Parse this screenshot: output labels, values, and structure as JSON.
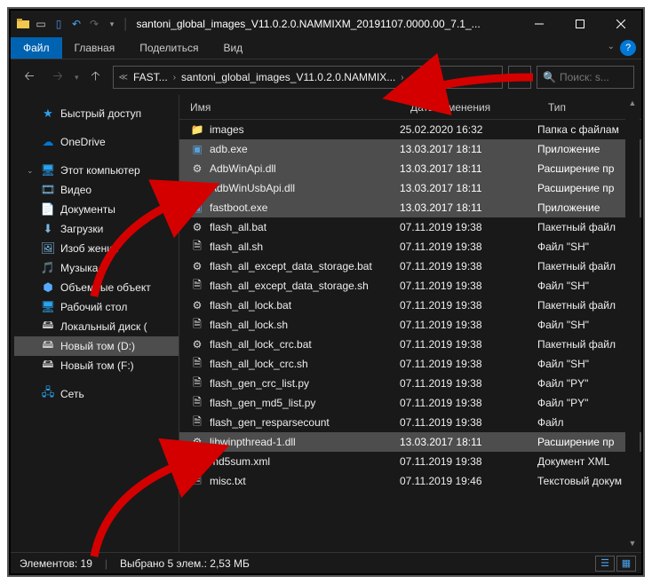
{
  "window": {
    "title": "santoni_global_images_V11.0.2.0.NAMMIXM_20191107.0000.00_7.1_..."
  },
  "ribbon": {
    "file": "Файл",
    "home": "Главная",
    "share": "Поделиться",
    "view": "Вид"
  },
  "address": {
    "crumb1": "FAST...",
    "crumb2": "santoni_global_images_V11.0.2.0.NAMMIX...",
    "search_placeholder": "Поиск: s..."
  },
  "nav": {
    "quick": "Быстрый доступ",
    "onedrive": "OneDrive",
    "pc": "Этот компьютер",
    "video": "Видео",
    "docs": "Документы",
    "downloads": "Загрузки",
    "images": "Изоб        жения",
    "music": "Музыка",
    "objects3d": "Объемные объект",
    "desktop": "Рабочий стол",
    "cdrive": "Локальный диск (",
    "ddrive": "Новый том (D:)",
    "fdrive": "Новый том (F:)",
    "network": "Сеть"
  },
  "columns": {
    "name": "Имя",
    "date": "Дата изменения",
    "type": "Тип"
  },
  "rows": [
    {
      "icon": "folder",
      "name": "images",
      "date": "25.02.2020 16:32",
      "type": "Папка с файлам",
      "sel": false
    },
    {
      "icon": "exe",
      "name": "adb.exe",
      "date": "13.03.2017 18:11",
      "type": "Приложение",
      "sel": true
    },
    {
      "icon": "dll",
      "name": "AdbWinApi.dll",
      "date": "13.03.2017 18:11",
      "type": "Расширение пр",
      "sel": true
    },
    {
      "icon": "dll",
      "name": "AdbWinUsbApi.dll",
      "date": "13.03.2017 18:11",
      "type": "Расширение пр",
      "sel": true
    },
    {
      "icon": "exe",
      "name": "fastboot.exe",
      "date": "13.03.2017 18:11",
      "type": "Приложение",
      "sel": true
    },
    {
      "icon": "bat",
      "name": "flash_all.bat",
      "date": "07.11.2019 19:38",
      "type": "Пакетный файл",
      "sel": false
    },
    {
      "icon": "file",
      "name": "flash_all.sh",
      "date": "07.11.2019 19:38",
      "type": "Файл \"SH\"",
      "sel": false
    },
    {
      "icon": "bat",
      "name": "flash_all_except_data_storage.bat",
      "date": "07.11.2019 19:38",
      "type": "Пакетный файл",
      "sel": false
    },
    {
      "icon": "file",
      "name": "flash_all_except_data_storage.sh",
      "date": "07.11.2019 19:38",
      "type": "Файл \"SH\"",
      "sel": false
    },
    {
      "icon": "bat",
      "name": "flash_all_lock.bat",
      "date": "07.11.2019 19:38",
      "type": "Пакетный файл",
      "sel": false
    },
    {
      "icon": "file",
      "name": "flash_all_lock.sh",
      "date": "07.11.2019 19:38",
      "type": "Файл \"SH\"",
      "sel": false
    },
    {
      "icon": "bat",
      "name": "flash_all_lock_crc.bat",
      "date": "07.11.2019 19:38",
      "type": "Пакетный файл",
      "sel": false
    },
    {
      "icon": "file",
      "name": "flash_all_lock_crc.sh",
      "date": "07.11.2019 19:38",
      "type": "Файл \"SH\"",
      "sel": false
    },
    {
      "icon": "file",
      "name": "flash_gen_crc_list.py",
      "date": "07.11.2019 19:38",
      "type": "Файл \"PY\"",
      "sel": false
    },
    {
      "icon": "file",
      "name": "flash_gen_md5_list.py",
      "date": "07.11.2019 19:38",
      "type": "Файл \"PY\"",
      "sel": false
    },
    {
      "icon": "file",
      "name": "flash_gen_resparsecount",
      "date": "07.11.2019 19:38",
      "type": "Файл",
      "sel": false
    },
    {
      "icon": "dll",
      "name": "libwinpthread-1.dll",
      "date": "13.03.2017 18:11",
      "type": "Расширение пр",
      "sel": true
    },
    {
      "icon": "file",
      "name": "md5sum.xml",
      "date": "07.11.2019 19:38",
      "type": "Документ XML",
      "sel": false
    },
    {
      "icon": "file",
      "name": "misc.txt",
      "date": "07.11.2019 19:46",
      "type": "Текстовый докум",
      "sel": false
    }
  ],
  "status": {
    "count": "Элементов: 19",
    "selected": "Выбрано 5 элем.: 2,53 МБ"
  },
  "icons": {
    "folder": "📁",
    "exe": "▣",
    "dll": "⚙",
    "bat": "⚙",
    "file": "🗎",
    "star": "★",
    "cloud": "☁",
    "pc": "🖥",
    "vid": "🎞",
    "doc": "📄",
    "down": "⬇",
    "img": "🖼",
    "mus": "🎵",
    "obj": "⬢",
    "desk": "🖥",
    "drive": "🖴",
    "net": "🖧"
  }
}
